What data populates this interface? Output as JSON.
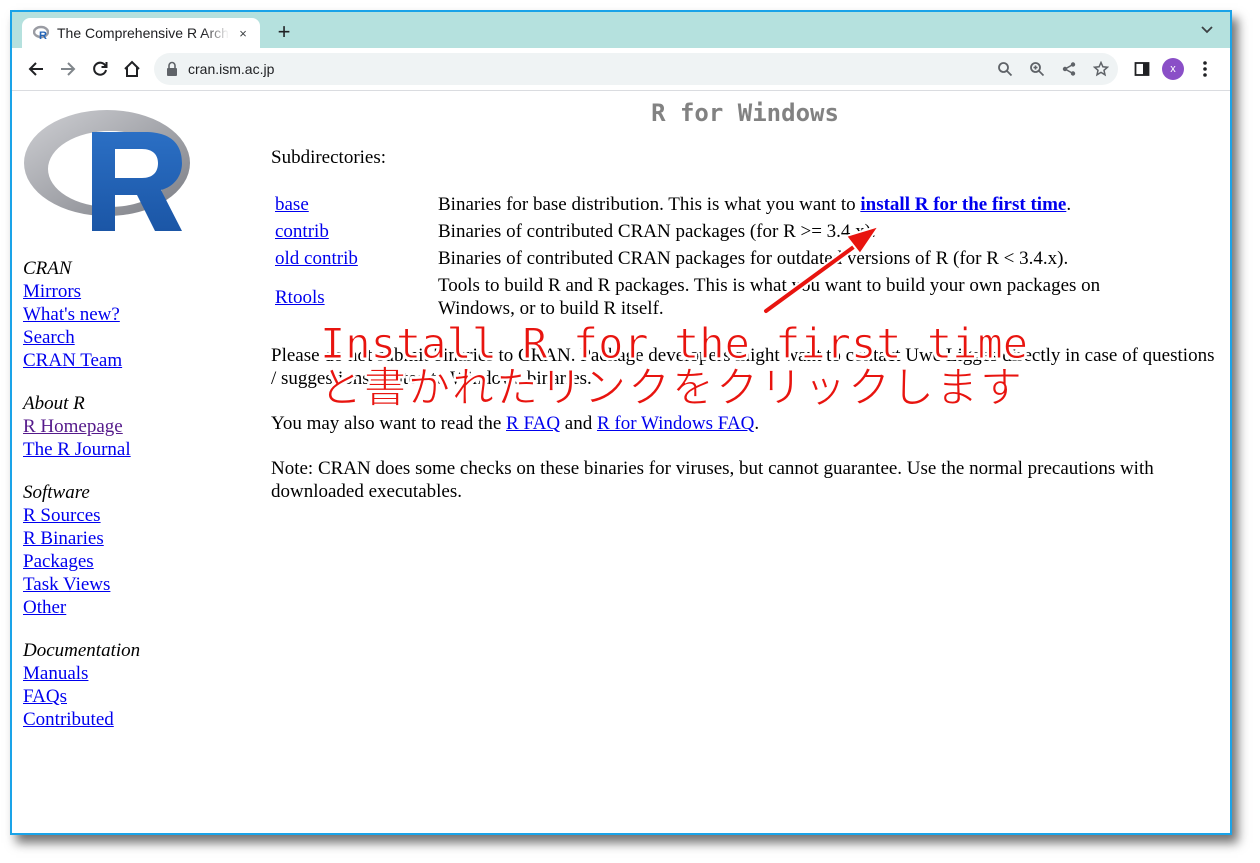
{
  "browser": {
    "tab_title": "The Comprehensive R Archive Network",
    "tab_close": "×",
    "new_tab": "+",
    "url": "cran.ism.ac.jp",
    "avatar_initial": "x",
    "frame_color": "#1aa3e8",
    "tabstrip_color": "#b5e1de",
    "icons": [
      "back-icon",
      "forward-icon",
      "reload-icon",
      "home-icon",
      "lock-icon",
      "search-icon",
      "zoom-icon",
      "share-icon",
      "star-icon",
      "side-panel-icon",
      "more-icon",
      "tab-menu-icon"
    ]
  },
  "sidebar": {
    "groups": [
      {
        "heading": "CRAN",
        "links": [
          "Mirrors",
          "What's new?",
          "Search",
          "CRAN Team"
        ]
      },
      {
        "heading": "About R",
        "links": [
          "R Homepage",
          "The R Journal"
        ]
      },
      {
        "heading": "Software",
        "links": [
          "R Sources",
          "R Binaries",
          "Packages",
          "Task Views",
          "Other"
        ]
      },
      {
        "heading": "Documentation",
        "links": [
          "Manuals",
          "FAQs",
          "Contributed"
        ]
      }
    ]
  },
  "main": {
    "title": "R for Windows",
    "subdirectories_label": "Subdirectories:",
    "rows": [
      {
        "name": "base",
        "desc_before": "Binaries for base distribution. This is what you want to ",
        "desc_link": "install R for the first time",
        "desc_after": "."
      },
      {
        "name": "contrib",
        "desc_before": "Binaries of contributed CRAN packages (for R >= 3.4.x).",
        "desc_link": "",
        "desc_after": ""
      },
      {
        "name": "old contrib",
        "desc_before": "Binaries of contributed CRAN packages for outdated versions of R (for R < 3.4.x).",
        "desc_link": "",
        "desc_after": ""
      },
      {
        "name": "Rtools",
        "desc_before": "Tools to build R and R packages. This is what you want to build your own packages on Windows, or to build R itself.",
        "desc_link": "",
        "desc_after": ""
      }
    ],
    "para1": "Please do not submit binaries to CRAN. Package developers might want to contact Uwe Ligges directly in case of questions / suggestions related to Windows binaries.",
    "para2_before": "You may also want to read the ",
    "para2_link1": "R FAQ",
    "para2_mid": " and ",
    "para2_link2": "R for Windows FAQ",
    "para2_after": ".",
    "para3": "Note: CRAN does some checks on these binaries for viruses, but cannot guarantee. Use the normal precautions with downloaded executables."
  },
  "annotation": {
    "line1": "Install R for the first time",
    "line2": "と書かれたリンクをクリックします",
    "color": "#e8140f"
  }
}
